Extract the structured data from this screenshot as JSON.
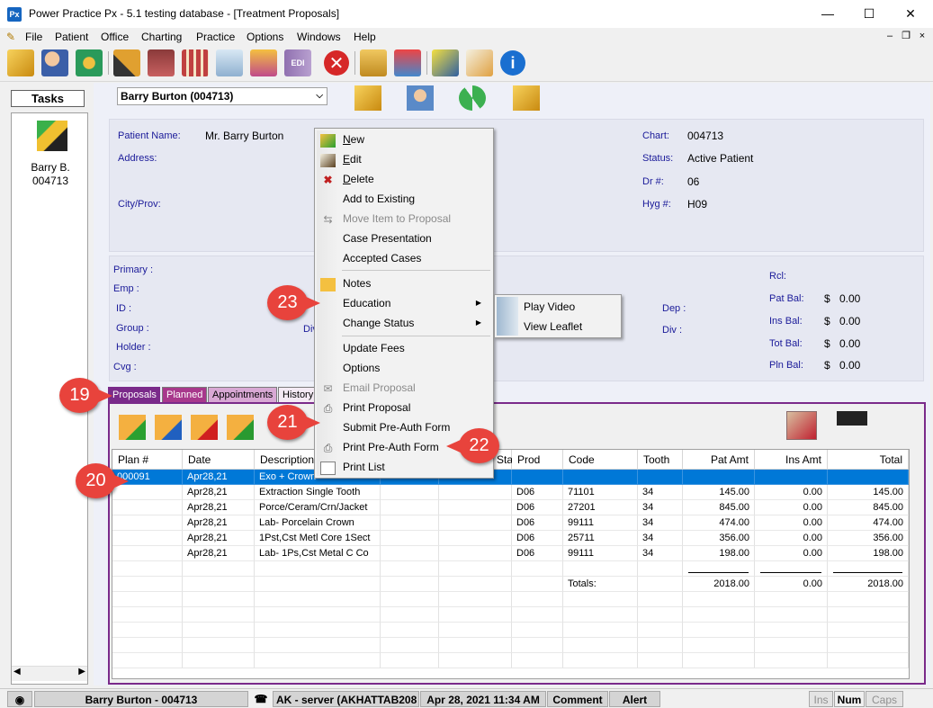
{
  "window": {
    "title": "Power Practice Px - 5.1 testing database - [Treatment Proposals]",
    "app_icon": "Px"
  },
  "menubar": [
    "File",
    "Patient",
    "Office",
    "Charting",
    "Practice",
    "Options",
    "Windows",
    "Help"
  ],
  "tasks": {
    "title": "Tasks",
    "user_name": "Barry B.",
    "user_id": "004713"
  },
  "patient_select": {
    "value": "Barry Burton (004713)"
  },
  "patient_info": {
    "name_label": "Patient Name:",
    "name": "Mr. Barry Burton",
    "address_label": "Address:",
    "city_label": "City/Prov:",
    "chart_label": "Chart:",
    "chart": "004713",
    "status_label": "Status:",
    "status": "Active Patient",
    "dr_label": "Dr #:",
    "dr": "06",
    "hyg_label": "Hyg #:",
    "hyg": "H09"
  },
  "insurance": {
    "primary_label": "Primary :",
    "emp_label": "Emp :",
    "id_label": "ID :",
    "group_label": "Group :",
    "holder_label": "Holder :",
    "cvg_label": "Cvg :",
    "div_label": "Div",
    "dep_label": "Dep :",
    "div2_label": "Div :",
    "rcl_label": "Rcl:",
    "pat_bal_label": "Pat Bal:",
    "pat_bal": "0.00",
    "ins_bal_label": "Ins Bal:",
    "ins_bal": "0.00",
    "tot_bal_label": "Tot Bal:",
    "tot_bal": "0.00",
    "pln_bal_label": "Pln Bal:",
    "pln_bal": "0.00",
    "currency": "$"
  },
  "tabs": [
    "Proposals",
    "Planned",
    "Appointments",
    "History"
  ],
  "grid": {
    "headers": [
      "Plan #",
      "Date",
      "Description",
      "",
      "Status",
      "Prod",
      "Code",
      "Tooth",
      "Pat Amt",
      "Ins Amt",
      "Total"
    ],
    "selected_row": {
      "plan": "000091",
      "date": "Apr28,21",
      "description": "Exo + Crown"
    },
    "rows": [
      {
        "date": "Apr28,21",
        "description": "Extraction Single Tooth",
        "prod": "D06",
        "code": "71101",
        "tooth": "34",
        "pat_amt": "145.00",
        "ins_amt": "0.00",
        "total": "145.00"
      },
      {
        "date": "Apr28,21",
        "description": "Porce/Ceram/Crn/Jacket",
        "prod": "D06",
        "code": "27201",
        "tooth": "34",
        "pat_amt": "845.00",
        "ins_amt": "0.00",
        "total": "845.00"
      },
      {
        "date": "Apr28,21",
        "description": "Lab- Porcelain Crown",
        "prod": "D06",
        "code": "99111",
        "tooth": "34",
        "pat_amt": "474.00",
        "ins_amt": "0.00",
        "total": "474.00"
      },
      {
        "date": "Apr28,21",
        "description": "1Pst,Cst Metl Core 1Sect",
        "prod": "D06",
        "code": "25711",
        "tooth": "34",
        "pat_amt": "356.00",
        "ins_amt": "0.00",
        "total": "356.00"
      },
      {
        "date": "Apr28,21",
        "description": "Lab- 1Ps,Cst Metal C Co",
        "prod": "D06",
        "code": "99111",
        "tooth": "34",
        "pat_amt": "198.00",
        "ins_amt": "0.00",
        "total": "198.00"
      }
    ],
    "totals_label": "Totals:",
    "totals": {
      "pat_amt": "2018.00",
      "ins_amt": "0.00",
      "total": "2018.00"
    }
  },
  "context_menu": {
    "items": [
      {
        "label": "New",
        "underline": "N"
      },
      {
        "label": "Edit",
        "underline": "E"
      },
      {
        "label": "Delete",
        "underline": "D"
      },
      {
        "label": "Add to Existing"
      },
      {
        "label": "Move Item to Proposal",
        "disabled": true
      },
      {
        "label": "Case Presentation"
      },
      {
        "label": "Accepted Cases"
      },
      {
        "label": "Notes"
      },
      {
        "label": "Education"
      },
      {
        "label": "Change Status"
      },
      {
        "label": "Update Fees"
      },
      {
        "label": "Options"
      },
      {
        "label": "Email Proposal",
        "disabled": true
      },
      {
        "label": "Print Proposal"
      },
      {
        "label": "Submit Pre-Auth Form"
      },
      {
        "label": "Print Pre-Auth Form"
      },
      {
        "label": "Print List"
      }
    ]
  },
  "submenu": [
    "Play Video",
    "View Leaflet"
  ],
  "callouts": [
    "19",
    "20",
    "21",
    "22",
    "23"
  ],
  "statusbar": {
    "patient": "Barry Burton - 004713",
    "server": "AK - server (AKHATTAB208",
    "datetime": "Apr 28, 2021 11:34 AM",
    "comment": "Comment",
    "alert": "Alert",
    "ins": "Ins",
    "num": "Num",
    "caps": "Caps"
  },
  "colors": {
    "selection": "#0078d7",
    "proposal_frame": "#7a2a8a",
    "callout": "#e8433c",
    "label": "#1a1a99"
  }
}
